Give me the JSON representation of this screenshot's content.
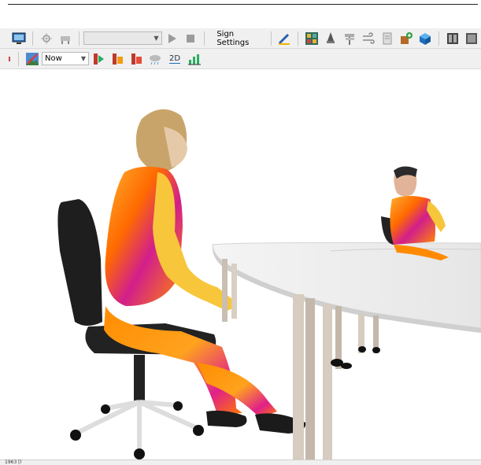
{
  "toolbar_top": {
    "scene_selector": {
      "value": ""
    },
    "sign_settings_label": "Sign Settings",
    "icons": [
      "monitor-icon",
      "target-icon",
      "furniture-icon",
      "play-icon",
      "stop-icon",
      "pen-icon",
      "grid-icon",
      "rocket-icon",
      "signpost-icon",
      "wind-icon",
      "document-icon",
      "add-object-icon",
      "cube-icon",
      "film-icon",
      "panel-icon"
    ]
  },
  "toolbar_bottom": {
    "time_selector": {
      "value": "Now"
    },
    "view_2d_label": "2D",
    "icons": [
      "landscape-icon",
      "run-green-icon",
      "run-orange-icon",
      "run-red-icon",
      "cloud-icon",
      "view-2d-icon",
      "chart-bars-icon"
    ]
  },
  "viewport": {
    "description_colors": {
      "hot": "#ff8a00",
      "warm": "#ffd23c",
      "cool": "#b01a9a"
    }
  },
  "status": {
    "text": "1963 [l"
  }
}
